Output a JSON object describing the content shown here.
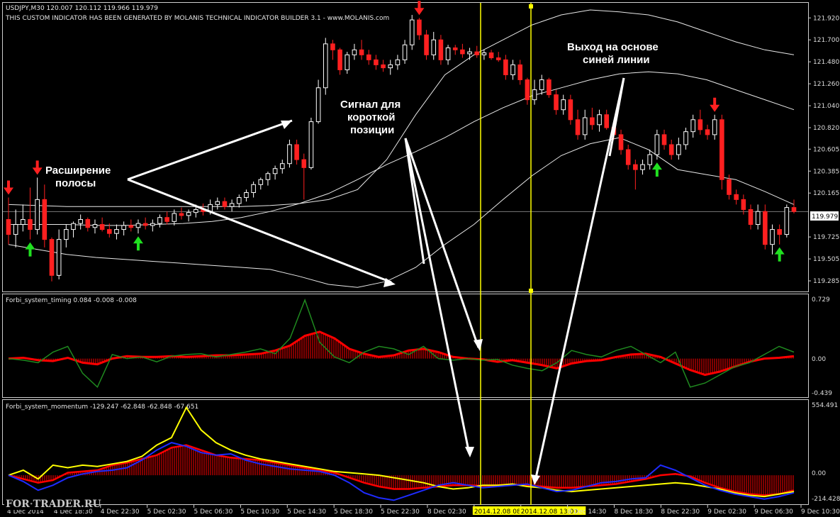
{
  "colors": {
    "background": "#000000",
    "grid": "#3a3a3a",
    "bull": "#ffffff",
    "bear": "#ff2020",
    "band": "#e8e8e8",
    "vline": "#ffff00",
    "up_arrow": "#20e020",
    "down_arrow": "#ff2020",
    "timing_green": "#1f8a1f",
    "hist_red": "#ff0000",
    "momentum_yellow": "#ffff00",
    "momentum_blue": "#1e2bff"
  },
  "main": {
    "title": "USDJPY,M30  120.007 120.112 119.966 119.979",
    "subtitle": "THIS CUSTOM INDICATOR HAS BEEN GENERATED BY MOLANIS TECHNICAL INDICATOR BUILDER 3.1 - www.MOLANIS.com",
    "price_ticks": [
      "121.920",
      "121.700",
      "121.480",
      "121.260",
      "121.040",
      "120.820",
      "120.605",
      "120.385",
      "120.165",
      "119.725",
      "119.505",
      "119.285"
    ],
    "last_price": "119.979"
  },
  "timing": {
    "title": "Forbi_system_timing 0.084 -0.008 -0.008",
    "ticks": [
      "0.729",
      "0.00",
      "-0.439"
    ]
  },
  "momentum": {
    "title": "Forbi_system_momentum -129.247 -62.848 -62.848 -67.651",
    "ticks": [
      "554.491",
      "0.00",
      "-214.428"
    ]
  },
  "x_labels": [
    "4 Dec 2014",
    "4 Dec 18:30",
    "4 Dec 22:30",
    "5 Dec 02:30",
    "5 Dec 06:30",
    "5 Dec 10:30",
    "5 Dec 14:30",
    "5 Dec 18:30",
    "5 Dec 22:30",
    "8 Dec 02:30",
    "2014.12.08 08:30",
    "2014.12.08 13:00",
    "8 Dec 14:30",
    "8 Dec 18:30",
    "8 Dec 22:30",
    "9 Dec 02:30",
    "9 Dec 06:30",
    "9 Dec 10:30"
  ],
  "annotations": {
    "band_expansion": [
      "Расширение",
      "полосы"
    ],
    "short_signal": [
      "Сигнал для",
      "короткой",
      "позиции"
    ],
    "exit": [
      "Выход на основе",
      "синей линии"
    ]
  },
  "watermark": "FORTRADER.RU",
  "chart_data": [
    {
      "type": "candlestick",
      "title": "USDJPY,M30",
      "ylim": [
        119.2,
        122.0
      ],
      "candles": [
        [
          119.9,
          120.12,
          119.65,
          119.75
        ],
        [
          119.75,
          120.0,
          119.62,
          119.85
        ],
        [
          119.85,
          120.05,
          119.78,
          119.9
        ],
        [
          119.9,
          120.22,
          119.7,
          119.8
        ],
        [
          119.8,
          120.32,
          119.75,
          120.1
        ],
        [
          120.1,
          120.25,
          119.62,
          119.7
        ],
        [
          119.7,
          119.72,
          119.28,
          119.34
        ],
        [
          119.34,
          119.8,
          119.3,
          119.7
        ],
        [
          119.7,
          119.85,
          119.62,
          119.8
        ],
        [
          119.8,
          119.88,
          119.72,
          119.86
        ],
        [
          119.86,
          119.95,
          119.8,
          119.9
        ],
        [
          119.9,
          119.92,
          119.78,
          119.82
        ],
        [
          119.82,
          119.9,
          119.76,
          119.85
        ],
        [
          119.85,
          119.92,
          119.78,
          119.8
        ],
        [
          119.8,
          119.86,
          119.72,
          119.76
        ],
        [
          119.76,
          119.85,
          119.7,
          119.8
        ],
        [
          119.8,
          119.88,
          119.74,
          119.84
        ],
        [
          119.84,
          119.9,
          119.78,
          119.82
        ],
        [
          119.82,
          119.9,
          119.76,
          119.86
        ],
        [
          119.86,
          119.92,
          119.8,
          119.84
        ],
        [
          119.84,
          119.9,
          119.78,
          119.86
        ],
        [
          119.86,
          119.95,
          119.82,
          119.92
        ],
        [
          119.92,
          119.98,
          119.85,
          119.88
        ],
        [
          119.88,
          120.0,
          119.84,
          119.96
        ],
        [
          119.96,
          120.02,
          119.9,
          119.94
        ],
        [
          119.94,
          120.0,
          119.88,
          119.97
        ],
        [
          119.97,
          120.05,
          119.92,
          120.0
        ],
        [
          120.0,
          120.06,
          119.94,
          119.98
        ],
        [
          119.98,
          120.1,
          119.95,
          120.05
        ],
        [
          120.05,
          120.12,
          120.0,
          120.08
        ],
        [
          120.08,
          120.12,
          120.0,
          120.03
        ],
        [
          120.03,
          120.1,
          119.98,
          120.06
        ],
        [
          120.06,
          120.15,
          120.02,
          120.12
        ],
        [
          120.12,
          120.2,
          120.08,
          120.17
        ],
        [
          120.17,
          120.28,
          120.12,
          120.25
        ],
        [
          120.25,
          120.32,
          120.2,
          120.3
        ],
        [
          120.3,
          120.38,
          120.24,
          120.36
        ],
        [
          120.36,
          120.44,
          120.3,
          120.41
        ],
        [
          120.41,
          120.5,
          120.36,
          120.46
        ],
        [
          120.46,
          120.7,
          120.42,
          120.65
        ],
        [
          120.65,
          120.7,
          120.45,
          120.5
        ],
        [
          120.5,
          120.56,
          120.1,
          120.42
        ],
        [
          120.42,
          120.92,
          120.4,
          120.88
        ],
        [
          120.88,
          121.3,
          120.86,
          121.22
        ],
        [
          121.22,
          121.72,
          121.15,
          121.66
        ],
        [
          121.66,
          121.7,
          121.5,
          121.6
        ],
        [
          121.6,
          121.62,
          121.35,
          121.4
        ],
        [
          121.4,
          121.58,
          121.36,
          121.55
        ],
        [
          121.55,
          121.66,
          121.5,
          121.6
        ],
        [
          121.6,
          121.7,
          121.5,
          121.55
        ],
        [
          121.55,
          121.6,
          121.45,
          121.5
        ],
        [
          121.5,
          121.55,
          121.4,
          121.45
        ],
        [
          121.45,
          121.5,
          121.38,
          121.42
        ],
        [
          121.42,
          121.5,
          121.35,
          121.45
        ],
        [
          121.45,
          121.55,
          121.4,
          121.5
        ],
        [
          121.5,
          121.7,
          121.46,
          121.65
        ],
        [
          121.65,
          121.95,
          121.6,
          121.9
        ],
        [
          121.9,
          121.92,
          121.7,
          121.75
        ],
        [
          121.75,
          121.8,
          121.5,
          121.55
        ],
        [
          121.55,
          121.78,
          121.5,
          121.7
        ],
        [
          121.7,
          121.75,
          121.45,
          121.5
        ],
        [
          121.5,
          121.65,
          121.45,
          121.62
        ],
        [
          121.62,
          121.65,
          121.55,
          121.6
        ],
        [
          121.6,
          121.66,
          121.52,
          121.56
        ],
        [
          121.56,
          121.62,
          121.5,
          121.58
        ],
        [
          121.58,
          121.64,
          121.52,
          121.55
        ],
        [
          121.55,
          121.6,
          121.5,
          121.57
        ],
        [
          121.57,
          121.6,
          121.5,
          121.52
        ],
        [
          121.52,
          121.58,
          121.48,
          121.5
        ],
        [
          121.5,
          121.55,
          121.3,
          121.35
        ],
        [
          121.35,
          121.5,
          121.3,
          121.45
        ],
        [
          121.45,
          121.5,
          121.25,
          121.3
        ],
        [
          121.3,
          121.32,
          121.05,
          121.1
        ],
        [
          121.1,
          121.3,
          121.05,
          121.2
        ],
        [
          121.2,
          121.35,
          121.15,
          121.3
        ],
        [
          121.3,
          121.32,
          121.12,
          121.15
        ],
        [
          121.15,
          121.2,
          120.95,
          121.0
        ],
        [
          121.0,
          121.15,
          120.95,
          121.1
        ],
        [
          121.1,
          121.15,
          120.85,
          120.9
        ],
        [
          120.9,
          121.0,
          120.7,
          120.75
        ],
        [
          120.75,
          121.0,
          120.7,
          120.92
        ],
        [
          120.92,
          121.02,
          120.8,
          120.85
        ],
        [
          120.85,
          121.0,
          120.78,
          120.95
        ],
        [
          120.95,
          121.0,
          120.8,
          120.82
        ],
        [
          120.82,
          120.85,
          120.7,
          120.75
        ],
        [
          120.75,
          120.8,
          120.55,
          120.6
        ],
        [
          120.6,
          120.65,
          120.4,
          120.45
        ],
        [
          120.45,
          120.5,
          120.2,
          120.4
        ],
        [
          120.4,
          120.5,
          120.35,
          120.45
        ],
        [
          120.45,
          120.6,
          120.4,
          120.55
        ],
        [
          120.55,
          120.8,
          120.5,
          120.75
        ],
        [
          120.75,
          120.8,
          120.6,
          120.65
        ],
        [
          120.65,
          120.7,
          120.5,
          120.55
        ],
        [
          120.55,
          120.72,
          120.5,
          120.65
        ],
        [
          120.65,
          120.82,
          120.6,
          120.78
        ],
        [
          120.78,
          120.95,
          120.72,
          120.9
        ],
        [
          120.9,
          121.0,
          120.75,
          120.8
        ],
        [
          120.8,
          120.85,
          120.7,
          120.75
        ],
        [
          120.75,
          120.95,
          120.7,
          120.9
        ],
        [
          120.9,
          120.95,
          120.2,
          120.3
        ],
        [
          120.3,
          120.35,
          120.1,
          120.15
        ],
        [
          120.15,
          120.2,
          120.05,
          120.1
        ],
        [
          120.1,
          120.15,
          119.95,
          120.0
        ],
        [
          120.0,
          120.05,
          119.8,
          119.85
        ],
        [
          119.85,
          120.05,
          119.8,
          119.98
        ],
        [
          119.98,
          120.05,
          119.6,
          119.65
        ],
        [
          119.65,
          119.85,
          119.55,
          119.8
        ],
        [
          119.8,
          119.85,
          119.65,
          119.75
        ],
        [
          119.75,
          120.05,
          119.72,
          120.02
        ],
        [
          120.02,
          120.1,
          119.96,
          119.98
        ]
      ],
      "signals": [
        {
          "candle": 0,
          "type": "sell"
        },
        {
          "candle": 3,
          "type": "buy"
        },
        {
          "candle": 4,
          "type": "sell"
        },
        {
          "candle": 18,
          "type": "buy"
        },
        {
          "candle": 57,
          "type": "sell"
        },
        {
          "candle": 90,
          "type": "buy"
        },
        {
          "candle": 98,
          "type": "sell"
        },
        {
          "candle": 107,
          "type": "buy"
        }
      ],
      "bands": {
        "upper": [
          120.05,
          120.04,
          120.03,
          120.03,
          120.03,
          120.03,
          120.03,
          120.03,
          120.03,
          120.04,
          120.06,
          120.1,
          120.2,
          120.5,
          120.95,
          121.35,
          121.55,
          121.7,
          121.85,
          121.95,
          122.0,
          121.98,
          121.95,
          121.88,
          121.78,
          121.68,
          121.6,
          121.55
        ],
        "middle": [
          119.85,
          119.85,
          119.85,
          119.84,
          119.84,
          119.85,
          119.86,
          119.88,
          119.92,
          119.98,
          120.06,
          120.16,
          120.3,
          120.45,
          120.58,
          120.72,
          120.88,
          121.02,
          121.14,
          121.22,
          121.3,
          121.36,
          121.38,
          121.36,
          121.3,
          121.2,
          121.1,
          121.0
        ],
        "lower": [
          119.65,
          119.6,
          119.55,
          119.52,
          119.5,
          119.48,
          119.46,
          119.44,
          119.42,
          119.4,
          119.33,
          119.25,
          119.22,
          119.28,
          119.42,
          119.65,
          119.85,
          120.1,
          120.34,
          120.54,
          120.66,
          120.72,
          120.6,
          120.4,
          120.35,
          120.3,
          120.18,
          120.05
        ]
      }
    },
    {
      "type": "line",
      "title": "Forbi_system_timing",
      "ylim": [
        -0.439,
        0.729
      ],
      "series": [
        {
          "name": "",
          "values": [
            0.0,
            0.01,
            -0.02,
            -0.03,
            0.01,
            -0.05,
            -0.07,
            0.0,
            0.03,
            0.02,
            0.02,
            0.03,
            0.02,
            0.03,
            0.04,
            0.04,
            0.05,
            0.06,
            0.1,
            0.16,
            0.28,
            0.33,
            0.25,
            0.12,
            0.06,
            0.02,
            0.04,
            0.1,
            0.12,
            0.08,
            0.02,
            0.0,
            -0.01,
            -0.04,
            -0.02,
            -0.05,
            -0.08,
            -0.12,
            -0.06,
            -0.03,
            -0.02,
            0.02,
            0.05,
            0.06,
            0.02,
            -0.06,
            -0.14,
            -0.2,
            -0.16,
            -0.1,
            -0.04,
            0.0,
            0.01,
            0.03
          ]
        },
        {
          "name": "",
          "values": [
            0.0,
            -0.02,
            -0.05,
            0.08,
            0.15,
            -0.18,
            -0.35,
            0.05,
            0.0,
            0.02,
            -0.04,
            0.03,
            0.05,
            0.06,
            0.02,
            0.05,
            0.08,
            0.12,
            0.06,
            0.25,
            0.72,
            0.2,
            0.02,
            -0.05,
            0.08,
            0.15,
            0.12,
            0.05,
            0.15,
            0.0,
            -0.02,
            0.0,
            -0.02,
            -0.01,
            -0.08,
            -0.12,
            -0.15,
            -0.05,
            0.1,
            0.05,
            0.02,
            0.1,
            0.15,
            0.05,
            -0.05,
            0.08,
            -0.35,
            -0.3,
            -0.2,
            -0.1,
            -0.05,
            0.05,
            0.15,
            0.08
          ]
        }
      ]
    },
    {
      "type": "line",
      "title": "Forbi_system_momentum",
      "ylim": [
        -214.428,
        554.491
      ],
      "series": [
        {
          "name": "",
          "values": [
            0.0,
            40.0,
            -30.0,
            80.0,
            60.0,
            80.0,
            70.0,
            90.0,
            110.0,
            150.0,
            240.0,
            300.0,
            540.0,
            360.0,
            260.0,
            200.0,
            160.0,
            130.0,
            110.0,
            90.0,
            70.0,
            50.0,
            30.0,
            20.0,
            10.0,
            0.0,
            -20.0,
            -40.0,
            -60.0,
            -90.0,
            -110.0,
            -100.0,
            -80.0,
            -80.0,
            -70.0,
            -90.0,
            -100.0,
            -120.0,
            -130.0,
            -120.0,
            -110.0,
            -100.0,
            -90.0,
            -80.0,
            -70.0,
            -60.0,
            -70.0,
            -90.0,
            -110.0,
            -140.0,
            -160.0,
            -170.0,
            -150.0,
            -130.0
          ]
        },
        {
          "name": "",
          "values": [
            0.0,
            -50.0,
            -120.0,
            -80.0,
            -20.0,
            10.0,
            30.0,
            40.0,
            60.0,
            120.0,
            200.0,
            260.0,
            230.0,
            180.0,
            160.0,
            170.0,
            120.0,
            90.0,
            70.0,
            50.0,
            40.0,
            30.0,
            0.0,
            -60.0,
            -140.0,
            -180.0,
            -200.0,
            -160.0,
            -120.0,
            -80.0,
            -60.0,
            -80.0,
            -100.0,
            -90.0,
            -80.0,
            -70.0,
            -100.0,
            -130.0,
            -120.0,
            -90.0,
            -60.0,
            -50.0,
            -30.0,
            -20.0,
            80.0,
            40.0,
            -20.0,
            -80.0,
            -120.0,
            -150.0,
            -170.0,
            -190.0,
            -170.0,
            -140.0
          ]
        },
        {
          "name": "",
          "values": [
            0.0,
            -30.0,
            -60.0,
            -40.0,
            20.0,
            30.0,
            40.0,
            80.0,
            100.0,
            130.0,
            160.0,
            220.0,
            240.0,
            200.0,
            160.0,
            140.0,
            130.0,
            120.0,
            100.0,
            80.0,
            60.0,
            40.0,
            20.0,
            -20.0,
            -60.0,
            -90.0,
            -110.0,
            -110.0,
            -100.0,
            -90.0,
            -80.0,
            -80.0,
            -85.0,
            -80.0,
            -75.0,
            -80.0,
            -90.0,
            -100.0,
            -100.0,
            -90.0,
            -80.0,
            -70.0,
            -50.0,
            -30.0,
            0.0,
            10.0,
            -10.0,
            -60.0,
            -100.0,
            -130.0,
            -150.0,
            -160.0,
            -150.0,
            -120.0
          ]
        }
      ]
    }
  ]
}
